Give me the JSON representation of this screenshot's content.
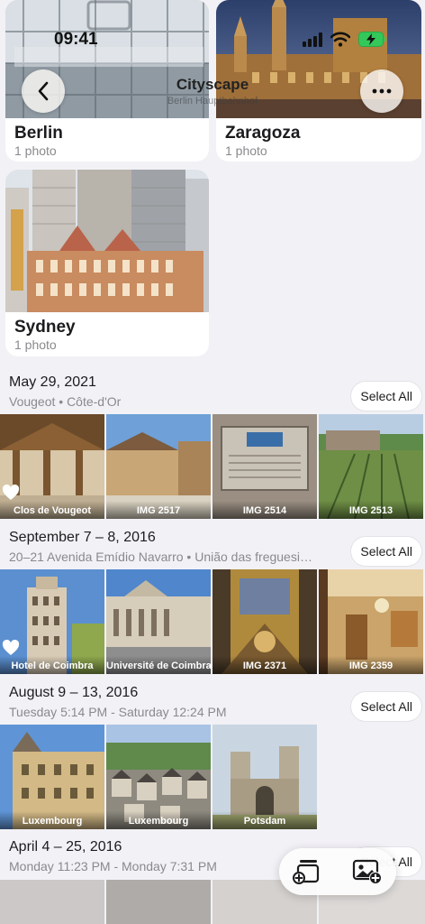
{
  "status_bar": {
    "time": "09:41"
  },
  "nav": {
    "title": "Cityscape",
    "subtitle": "Berlin Hauptbahnhof"
  },
  "albums": [
    {
      "title": "Berlin",
      "count": "1 photo"
    },
    {
      "title": "Zaragoza",
      "count": "1 photo"
    },
    {
      "title": "Sydney",
      "count": "1 photo"
    }
  ],
  "sections": [
    {
      "title": "May 29, 2021",
      "subtitle": "Vougeot • Côte-d'Or",
      "select_label": "Select All",
      "photos": [
        {
          "caption": "Clos de Vougeot",
          "favorite": true
        },
        {
          "caption": "IMG 2517",
          "favorite": false
        },
        {
          "caption": "IMG 2514",
          "favorite": false
        },
        {
          "caption": "IMG 2513",
          "favorite": false
        }
      ]
    },
    {
      "title": "September 7 – 8, 2016",
      "subtitle": "20–21 Avenida Emídio Navarro • União das freguesi…",
      "select_label": "Select All",
      "photos": [
        {
          "caption": "Hotel de Coimbra",
          "favorite": true
        },
        {
          "caption": "Université de Coimbra",
          "favorite": false
        },
        {
          "caption": "IMG 2371",
          "favorite": false
        },
        {
          "caption": "IMG 2359",
          "favorite": false
        }
      ]
    },
    {
      "title": "August 9 – 13, 2016",
      "subtitle": "Tuesday 5:14 PM - Saturday 12:24 PM",
      "select_label": "Select All",
      "photos": [
        {
          "caption": "Luxembourg",
          "favorite": false
        },
        {
          "caption": "Luxembourg",
          "favorite": false
        },
        {
          "caption": "Potsdam",
          "favorite": false
        }
      ]
    },
    {
      "title": "April 4 – 25, 2016",
      "subtitle": "Monday 11:23 PM - Monday 7:31 PM",
      "select_label": "Select All"
    }
  ],
  "toolbar": {
    "icons": [
      "add-to-album-icon",
      "add-photo-icon"
    ]
  },
  "colors": {
    "background": "#f2f1f6",
    "card": "#ffffff",
    "secondary_text": "#8a8a8e"
  }
}
